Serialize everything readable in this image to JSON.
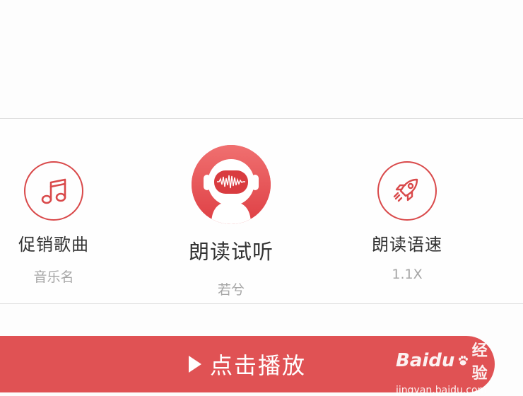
{
  "options": {
    "music": {
      "label": "促销歌曲",
      "value": "音乐名",
      "icon": "music-note-icon"
    },
    "voice": {
      "label": "朗读试听",
      "value": "若兮",
      "icon": "voice-avatar-icon"
    },
    "speed": {
      "label": "朗读语速",
      "value": "1.1X",
      "icon": "rocket-icon"
    }
  },
  "play_button": {
    "label": "点击播放",
    "icon": "play-icon"
  },
  "watermark": {
    "logo": "Baidu",
    "name": "经验",
    "url": "jingyan.baidu.com"
  },
  "colors": {
    "accent": "#e05254",
    "icon_stroke": "#d9494a",
    "label": "#333333",
    "sublabel": "#a6a6a6"
  }
}
